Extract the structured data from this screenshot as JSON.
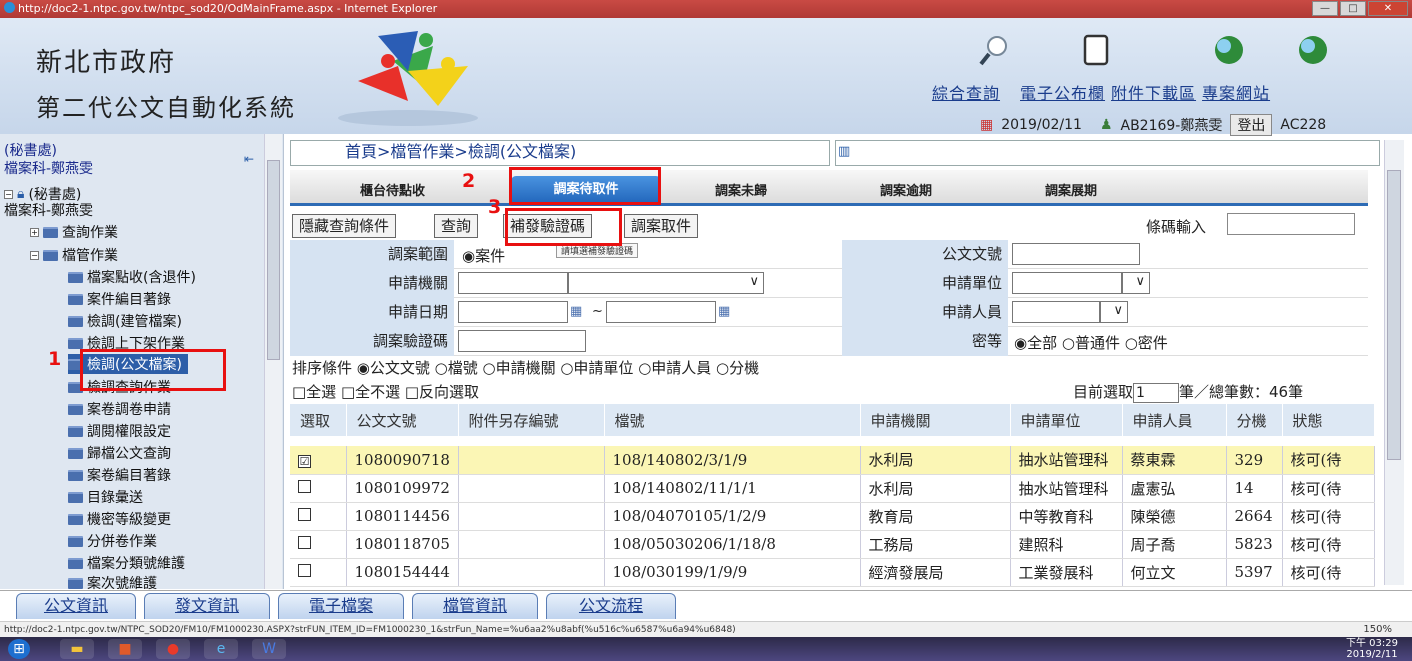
{
  "window": {
    "title": "http://doc2-1.ntpc.gov.tw/ntpc_sod20/OdMainFrame.aspx - Internet Explorer"
  },
  "header": {
    "org": "新北市政府",
    "system": "第二代公文自動化系統",
    "links": [
      "綜合查詢",
      "電子公布欄",
      "附件下載區",
      "專案網站"
    ],
    "date": "2019/02/11",
    "user": "AB2169-鄭燕雯",
    "logout": "登出",
    "code": "AC228"
  },
  "sidebar": {
    "dept": "(秘書處)",
    "user": "檔案科-鄭燕雯",
    "root": "(秘書處)",
    "root_user": "檔案科-鄭燕雯",
    "items": [
      "查詢作業",
      "檔管作業",
      "檔案點收(含退件)",
      "案件編目著錄",
      "檢調(建管檔案)",
      "檢調上下架作業",
      "檢調(公文檔案)",
      "檢調查詢作業",
      "案卷調卷申請",
      "調閱權限設定",
      "歸檔公文查詢",
      "案卷編目著錄",
      "目錄彙送",
      "機密等級變更",
      "分併卷作業",
      "檔案分類號維護",
      "案次號維護"
    ]
  },
  "breadcrumb": "首頁>檔管作業>檢調(公文檔案)",
  "tabs": [
    "櫃台待點收",
    "調案待取件",
    "調案未歸",
    "調案逾期",
    "調案展期"
  ],
  "toolbar": {
    "hide": "隱藏查詢條件",
    "query": "查詢",
    "reissue": "補發驗證碼",
    "pickup": "調案取件",
    "barcode": "條碼輸入"
  },
  "tooltip": "請填選補發驗證碼",
  "form": {
    "range_label": "調案範圍",
    "range_value": "◉案件",
    "docno_label": "公文文號",
    "org_label": "申請機關",
    "unit_label": "申請單位",
    "date_label": "申請日期",
    "tilde": "~",
    "person_label": "申請人員",
    "verify_label": "調案驗證碼",
    "secret_label": "密等",
    "secret_value": "◉全部 ○普通件 ○密件"
  },
  "sort": "排序條件 ◉公文文號 ○檔號 ○申請機關 ○申請單位 ○申請人員 ○分機",
  "select_opts": "□全選 □全不選 □反向選取",
  "counter": {
    "prefix": "目前選取",
    "value": "1",
    "suffix": "筆／總筆數：46筆"
  },
  "table": {
    "headers": [
      "選取",
      "公文文號",
      "附件另存編號",
      "檔號",
      "申請機關",
      "申請單位",
      "申請人員",
      "分機",
      "狀態"
    ],
    "rows": [
      {
        "checked": "☑",
        "docno": "1080090718",
        "att": "",
        "fileno": "108/140802/3/1/9",
        "org": "水利局",
        "unit": "抽水站管理科",
        "person": "蔡東霖",
        "ext": "329",
        "status": "核可(待"
      },
      {
        "checked": "",
        "docno": "1080109972",
        "att": "",
        "fileno": "108/140802/11/1/1",
        "org": "水利局",
        "unit": "抽水站管理科",
        "person": "盧憲弘",
        "ext": "14",
        "status": "核可(待"
      },
      {
        "checked": "",
        "docno": "1080114456",
        "att": "",
        "fileno": "108/04070105/1/2/9",
        "org": "教育局",
        "unit": "中等教育科",
        "person": "陳榮德",
        "ext": "2664",
        "status": "核可(待"
      },
      {
        "checked": "",
        "docno": "1080118705",
        "att": "",
        "fileno": "108/05030206/1/18/8",
        "org": "工務局",
        "unit": "建照科",
        "person": "周子喬",
        "ext": "5823",
        "status": "核可(待"
      },
      {
        "checked": "",
        "docno": "1080154444",
        "att": "",
        "fileno": "108/030199/1/9/9",
        "org": "經濟發展局",
        "unit": "工業發展科",
        "person": "何立文",
        "ext": "5397",
        "status": "核可(待"
      }
    ]
  },
  "bottom_tabs": [
    "公文資訊",
    "發文資訊",
    "電子檔案",
    "檔管資訊",
    "公文流程"
  ],
  "status": "http://doc2-1.ntpc.gov.tw/NTPC_SOD20/FM10/FM1000230.ASPX?strFUN_ITEM_ID=FM1000230_1&strFun_Name=%u6aa2%u8abf(%u516c%u6587%u6a94%u6848)",
  "zoom": "150%",
  "clock": {
    "time": "下午 03:29",
    "date": "2019/2/11"
  },
  "annotations": [
    "1",
    "2",
    "3"
  ]
}
